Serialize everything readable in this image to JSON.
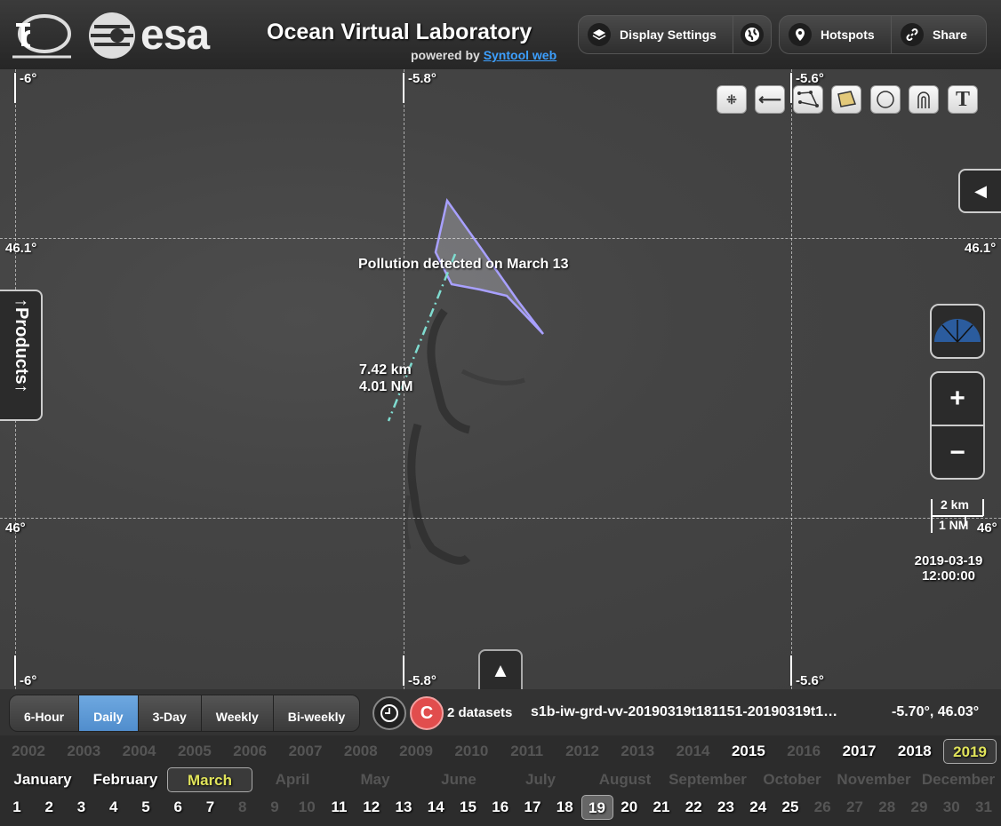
{
  "header": {
    "title": "Ocean Virtual Laboratory",
    "powered_by": "powered by",
    "powered_link": "Syntool web",
    "esa_logo": "esa",
    "buttons": {
      "display_settings": "Display Settings",
      "hotspots": "Hotspots",
      "share": "Share"
    }
  },
  "map": {
    "lon_labels": [
      "-6°",
      "-5.8°",
      "-5.6°"
    ],
    "lat_labels": [
      "46.1°",
      "46°"
    ],
    "annotation": "Pollution detected on March 13",
    "measure_km": "7.42 km",
    "measure_nm": "4.01 NM",
    "scale_km": "2 km",
    "scale_nm": "1 NM",
    "date": "2019-03-19",
    "time": "12:00:00",
    "products_tab": "↑Products↑",
    "zoom_in": "+",
    "zoom_out": "−",
    "collapse_right": "◀",
    "expand_up": "▲",
    "tools": [
      "point-tool-icon",
      "line-tool-icon",
      "polyline-tool-icon",
      "polygon-tool-icon",
      "circle-tool-icon",
      "magnet-tool-icon",
      "text-tool-icon"
    ],
    "polygon_color": "#a8a0ff",
    "measure_color": "#7fdcd0"
  },
  "bar": {
    "periods": [
      "6-Hour",
      "Daily",
      "3-Day",
      "Weekly",
      "Bi-weekly"
    ],
    "active_period": "Daily",
    "datasets_count": "2 datasets",
    "dataset_name": "s1b-iw-grd-vv-20190319t181151-20190319t1…",
    "cursor_coords": "-5.70°, 46.03°",
    "c_button": "C"
  },
  "timeline": {
    "years": [
      "2002",
      "2003",
      "2004",
      "2005",
      "2006",
      "2007",
      "2008",
      "2009",
      "2010",
      "2011",
      "2012",
      "2013",
      "2014",
      "2015",
      "2016",
      "2017",
      "2018",
      "2019"
    ],
    "years_active": [
      "2015",
      "2017",
      "2018",
      "2019"
    ],
    "year_selected": "2019",
    "months": [
      "January",
      "February",
      "March",
      "April",
      "May",
      "June",
      "July",
      "August",
      "September",
      "October",
      "November",
      "December"
    ],
    "months_active": [
      "January",
      "February",
      "March"
    ],
    "month_selected": "March",
    "days": [
      "1",
      "2",
      "3",
      "4",
      "5",
      "6",
      "7",
      "8",
      "9",
      "10",
      "11",
      "12",
      "13",
      "14",
      "15",
      "16",
      "17",
      "18",
      "19",
      "20",
      "21",
      "22",
      "23",
      "24",
      "25",
      "26",
      "27",
      "28",
      "29",
      "30",
      "31"
    ],
    "days_dim": [
      "8",
      "9",
      "10",
      "26",
      "27",
      "28",
      "29",
      "30",
      "31"
    ],
    "day_selected": "19"
  }
}
